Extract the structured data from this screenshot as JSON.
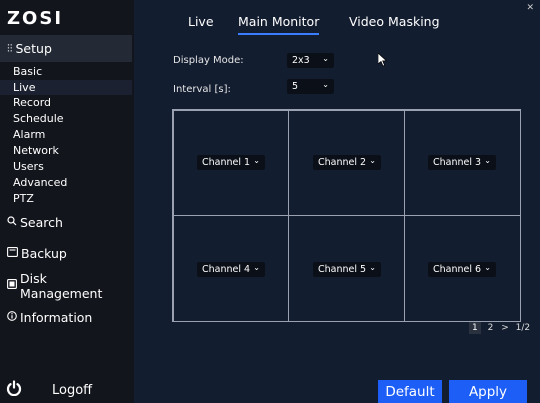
{
  "brand": {
    "logo_text": "ZOSI"
  },
  "sidebar": {
    "setup": {
      "icon": "sliders-icon",
      "label": "Setup"
    },
    "setup_items": [
      {
        "label": "Basic"
      },
      {
        "label": "Live",
        "active": true
      },
      {
        "label": "Record"
      },
      {
        "label": "Schedule"
      },
      {
        "label": "Alarm"
      },
      {
        "label": "Network"
      },
      {
        "label": "Users"
      },
      {
        "label": "Advanced"
      },
      {
        "label": "PTZ"
      }
    ],
    "search": {
      "icon": "search-icon",
      "label": "Search"
    },
    "backup": {
      "icon": "backup-icon",
      "label": "Backup"
    },
    "disk": {
      "icon": "disk-icon",
      "label": "Disk Management"
    },
    "info": {
      "icon": "info-icon",
      "label": "Information"
    },
    "logoff": {
      "icon": "power-icon",
      "label": "Logoff"
    }
  },
  "tabs": [
    {
      "label": "Live"
    },
    {
      "label": "Main Monitor",
      "active": true
    },
    {
      "label": "Video Masking"
    }
  ],
  "settings": {
    "display_mode_label": "Display Mode:",
    "display_mode_value": "2x3",
    "interval_label": "Interval [s]:",
    "interval_value": "5"
  },
  "channels": [
    {
      "label": "Channel 1"
    },
    {
      "label": "Channel 2"
    },
    {
      "label": "Channel 3"
    },
    {
      "label": "Channel 4"
    },
    {
      "label": "Channel 5"
    },
    {
      "label": "Channel 6"
    }
  ],
  "pager": {
    "page1": "1",
    "page2": "2",
    "next": ">",
    "summary": "1/2"
  },
  "buttons": {
    "default_label": "Default",
    "apply_label": "Apply"
  },
  "colors": {
    "accent": "#1d5ef6",
    "sidebar_bg": "#12151c",
    "main_bg": "#131d30"
  }
}
